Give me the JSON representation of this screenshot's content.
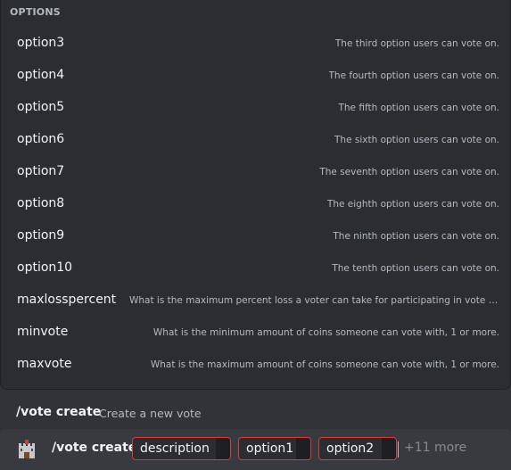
{
  "options_section": {
    "title": "OPTIONS",
    "items": [
      {
        "name": "option3",
        "description": "The third option users can vote on."
      },
      {
        "name": "option4",
        "description": "The fourth option users can vote on."
      },
      {
        "name": "option5",
        "description": "The fifth option users can vote on."
      },
      {
        "name": "option6",
        "description": "The sixth option users can vote on."
      },
      {
        "name": "option7",
        "description": "The seventh option users can vote on."
      },
      {
        "name": "option8",
        "description": "The eighth option users can vote on."
      },
      {
        "name": "option9",
        "description": "The ninth option users can vote on."
      },
      {
        "name": "option10",
        "description": "The tenth option users can vote on."
      },
      {
        "name": "maxlosspercent",
        "description": "What is the maximum percent loss a voter can take for participating in vote (0-1..."
      },
      {
        "name": "minvote",
        "description": "What is the minimum amount of coins someone can vote with, 1 or more."
      },
      {
        "name": "maxvote",
        "description": "What is the maximum amount of coins someone can vote with, 1 or more."
      }
    ]
  },
  "command_header": {
    "name": "/vote create",
    "description": "Create a new vote"
  },
  "input_bar": {
    "avatar_icon": "castle-icon",
    "command": "/vote create",
    "params": [
      {
        "name": "description"
      },
      {
        "name": "option1"
      },
      {
        "name": "option2"
      }
    ],
    "more_label": "+11 more"
  },
  "colors": {
    "background": "#313338",
    "panel": "#2b2d31",
    "input": "#383a40",
    "error_border": "#d83c3e"
  }
}
